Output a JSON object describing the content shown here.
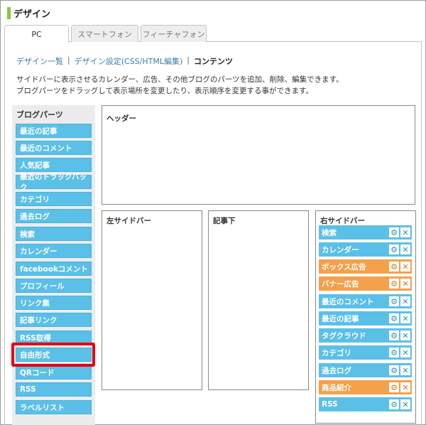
{
  "page": {
    "title": "デザイン"
  },
  "tabs": [
    {
      "label": "PC",
      "active": true
    },
    {
      "label": "スマートフォン",
      "active": false
    },
    {
      "label": "フィーチャフォン",
      "active": false
    }
  ],
  "breadcrumb": {
    "link1": "デザイン一覧",
    "link2": "デザイン設定(CSS/HTML編集)",
    "current": "コンテンツ",
    "separator": "|"
  },
  "description": {
    "line1": "サイドバーに表示させるカレンダー、広告、その他ブログのパーツを追加、削除、編集できます。",
    "line2": "ブログパーツをドラッグして表示場所を変更したり、表示順序を変更する事ができます。"
  },
  "parts_panel": {
    "title": "ブログパーツ",
    "items": [
      "最近の記事",
      "最近のコメント",
      "人気記事",
      "最近のトラックバック",
      "カテゴリ",
      "過去ログ",
      "検索",
      "カレンダー",
      "facebookコメント",
      "プロフィール",
      "リンク集",
      "記事リンク",
      "RSS取得",
      "自由形式",
      "QRコード",
      "RSS",
      "ラベルリスト"
    ],
    "highlighted": "自由形式"
  },
  "areas": {
    "header": "ヘッダー",
    "left_sidebar": "左サイドバー",
    "below_article": "記事下",
    "right_sidebar": "右サイドバー"
  },
  "right_sidebar_items": [
    {
      "label": "検索",
      "color": "blue"
    },
    {
      "label": "カレンダー",
      "color": "blue"
    },
    {
      "label": "ボックス広告",
      "color": "orange"
    },
    {
      "label": "バナー広告",
      "color": "orange"
    },
    {
      "label": "最近のコメント",
      "color": "blue"
    },
    {
      "label": "最近の記事",
      "color": "blue"
    },
    {
      "label": "タグクラウド",
      "color": "blue"
    },
    {
      "label": "カテゴリ",
      "color": "blue"
    },
    {
      "label": "過去ログ",
      "color": "blue"
    },
    {
      "label": "商品紹介",
      "color": "orange"
    },
    {
      "label": "RSS",
      "color": "blue"
    }
  ],
  "icons": {
    "settings": "gear-icon",
    "remove": "close-icon",
    "gear_glyph": "⚙",
    "close_glyph": "✕"
  },
  "colors": {
    "part_blue": "#5bc0e8",
    "part_orange": "#f5a04a",
    "heading_accent": "#8cc63f",
    "highlight_red": "#e60012"
  }
}
